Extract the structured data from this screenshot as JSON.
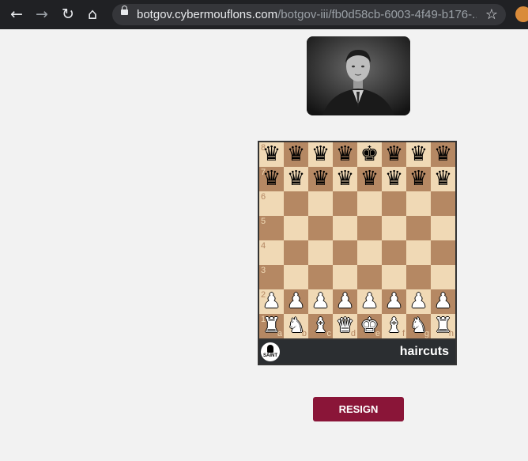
{
  "browser": {
    "url_host": "botgov.cybermouflons.com",
    "url_path": "/botgov-iii/fb0d58cb-6003-4f49-b176-..."
  },
  "board": {
    "ranks": [
      [
        "bq",
        "bq",
        "bq",
        "bq",
        "bk",
        "bq",
        "bq",
        "bq"
      ],
      [
        "bq",
        "bq",
        "bq",
        "bq",
        "bq",
        "bq",
        "bq",
        "bq"
      ],
      [
        "",
        "",
        "",
        "",
        "",
        "",
        "",
        ""
      ],
      [
        "",
        "",
        "",
        "",
        "",
        "",
        "",
        ""
      ],
      [
        "",
        "",
        "",
        "",
        "",
        "",
        "",
        ""
      ],
      [
        "",
        "",
        "",
        "",
        "",
        "",
        "",
        ""
      ],
      [
        "wp",
        "wp",
        "wp",
        "wp",
        "wp",
        "wp",
        "wp",
        "wp"
      ],
      [
        "wr",
        "wn",
        "wb",
        "wq",
        "wk",
        "wb",
        "wn",
        "wr"
      ]
    ],
    "rank_labels": [
      "8",
      "7",
      "6",
      "5",
      "4",
      "3",
      "2",
      "1"
    ],
    "file_labels": [
      "a",
      "b",
      "c",
      "d",
      "e",
      "f",
      "g",
      "h"
    ]
  },
  "player": {
    "name": "haircuts",
    "badge_text": "SAINT"
  },
  "actions": {
    "resign_label": "RESIGN"
  }
}
